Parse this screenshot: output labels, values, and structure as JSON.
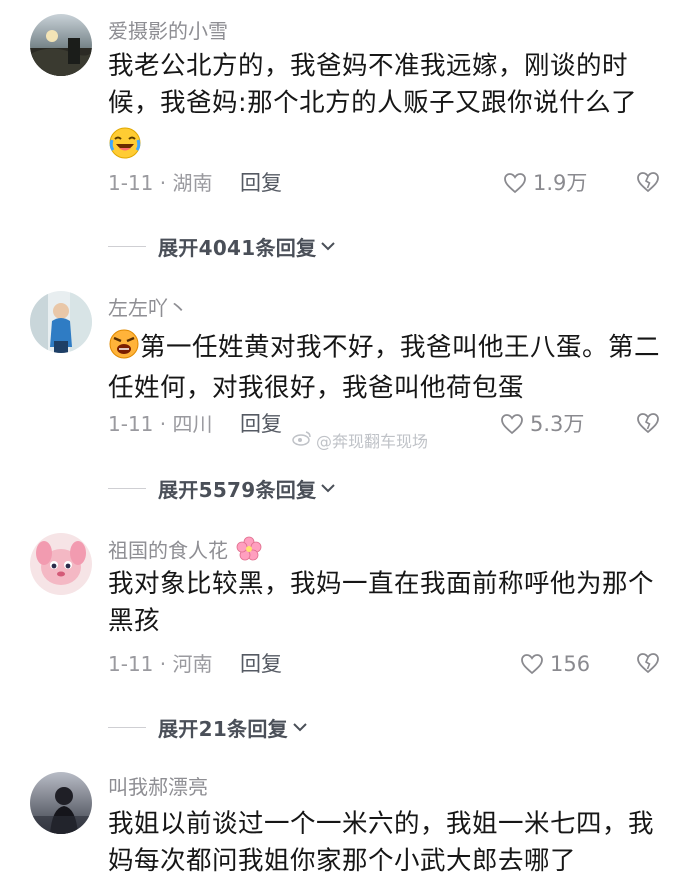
{
  "comments": [
    {
      "username": "爱摄影的小雪",
      "text": "我老公北方的，我爸妈不准我远嫁，刚谈的时候，我爸妈:那个北方的人贩子又跟你说什么了",
      "emoji_after": "laugh-cry-emoji",
      "date_location": "1-11 · 湖南",
      "reply_label": "回复",
      "likes": "1.9万",
      "expand_label": "展开4041条回复"
    },
    {
      "username": "左左吖丶",
      "emoji_before": "angry-emoji",
      "text": "第一任姓黄对我不好，我爸叫他王八蛋。第二任姓何，对我很好，我爸叫他荷包蛋",
      "date_location": "1-11 · 四川",
      "reply_label": "回复",
      "likes": "5.3万",
      "expand_label": "展开5579条回复"
    },
    {
      "username": "祖国的食人花",
      "username_emoji": "cherry-blossom-emoji",
      "text": "我对象比较黑，我妈一直在我面前称呼他为那个黑孩",
      "date_location": "1-11 · 河南",
      "reply_label": "回复",
      "likes": "156",
      "expand_label": "展开21条回复"
    },
    {
      "username": "叫我郝漂亮",
      "text": "我姐以前谈过一个一米六的，我姐一米七四，我妈每次都问我姐你家那个小武大郎去哪了"
    }
  ],
  "watermark": "@奔现翻车现场",
  "colors": {
    "username": "#8e8e93",
    "text": "#161616",
    "meta": "#9a9a9f",
    "expand": "#4a4f58"
  }
}
